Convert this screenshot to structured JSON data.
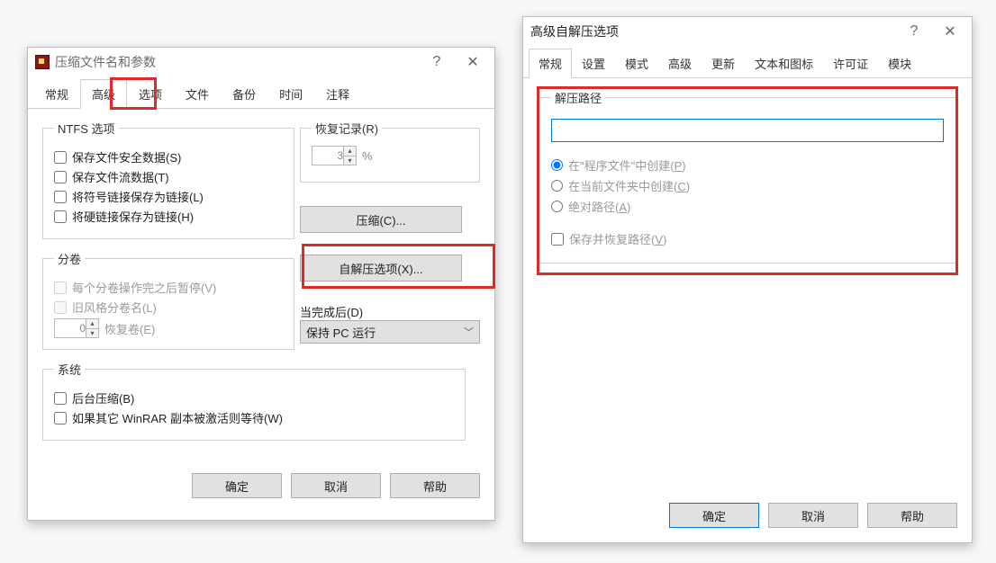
{
  "left": {
    "title": "压缩文件名和参数",
    "tabs": [
      "常规",
      "高级",
      "选项",
      "文件",
      "备份",
      "时间",
      "注释"
    ],
    "active_tab": "高级",
    "ntfs": {
      "legend": "NTFS 选项",
      "opts": [
        "保存文件安全数据(S)",
        "保存文件流数据(T)",
        "将符号链接保存为链接(L)",
        "将硬链接保存为链接(H)"
      ]
    },
    "recovery": {
      "legend": "恢复记录(R)",
      "value": "3",
      "pct": "%"
    },
    "compress_btn": "压缩(C)...",
    "sfx_btn": "自解压选项(X)...",
    "volumes": {
      "legend": "分卷",
      "pause": "每个分卷操作完之后暂停(V)",
      "oldstyle": "旧风格分卷名(L)",
      "recover_vol": "恢复卷(E)",
      "recover_val": "0"
    },
    "when_done": {
      "label": "当完成后(D)",
      "value": "保持 PC 运行"
    },
    "system": {
      "legend": "系统",
      "bg": "后台压缩(B)",
      "wait": "如果其它 WinRAR 副本被激活则等待(W)"
    },
    "buttons": {
      "ok": "确定",
      "cancel": "取消",
      "help": "帮助"
    }
  },
  "right": {
    "title": "高级自解压选项",
    "tabs": [
      "常规",
      "设置",
      "模式",
      "高级",
      "更新",
      "文本和图标",
      "许可证",
      "模块"
    ],
    "active_tab": "常规",
    "path_legend": "解压路径",
    "path_value": "",
    "radios": {
      "prog": "在\"程序文件\"中创建(P)",
      "curr": "在当前文件夹中创建(C)",
      "abs": "绝对路径(A)"
    },
    "save_restore": "保存并恢复路径(V)",
    "buttons": {
      "ok": "确定",
      "cancel": "取消",
      "help": "帮助"
    }
  }
}
